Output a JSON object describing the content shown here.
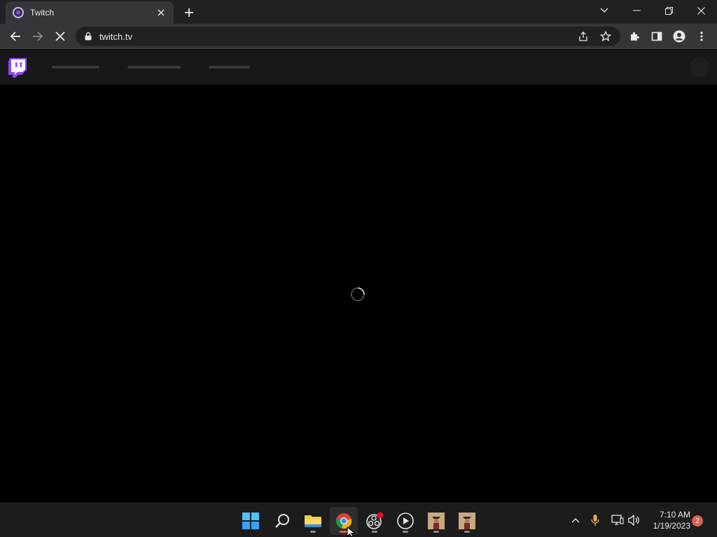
{
  "browser": {
    "tab": {
      "title": "Twitch",
      "favicon": "twitch-favicon-icon"
    },
    "url": "twitch.tv",
    "window_controls": [
      "tab-search-icon",
      "minimize-icon",
      "restore-icon",
      "close-icon"
    ],
    "toolbar_icons": [
      "back-icon",
      "forward-icon",
      "stop-icon",
      "lock-icon",
      "share-icon",
      "star-icon",
      "extensions-icon",
      "side-panel-icon",
      "profile-icon",
      "menu-icon"
    ]
  },
  "page": {
    "state": "loading",
    "colors": {
      "nav_bg": "#18181b",
      "brand": "#9146ff",
      "background": "#000000"
    }
  },
  "taskbar": {
    "apps": [
      {
        "name": "windows-start-icon",
        "active": false
      },
      {
        "name": "search-icon",
        "active": false
      },
      {
        "name": "file-explorer-icon",
        "active": false,
        "running": true
      },
      {
        "name": "chrome-icon",
        "active": true,
        "running": true
      },
      {
        "name": "obs-icon",
        "active": false,
        "running": true
      },
      {
        "name": "media-player-icon",
        "active": false,
        "running": true
      },
      {
        "name": "game-app-icon",
        "active": false,
        "running": true
      },
      {
        "name": "game-app-icon-2",
        "active": false,
        "running": true
      }
    ],
    "tray": [
      "chevron-up-icon",
      "microphone-icon",
      "network-icon",
      "volume-icon"
    ],
    "clock": {
      "time": "7:10 AM",
      "date": "1/19/2023"
    },
    "notification_count": "2"
  }
}
